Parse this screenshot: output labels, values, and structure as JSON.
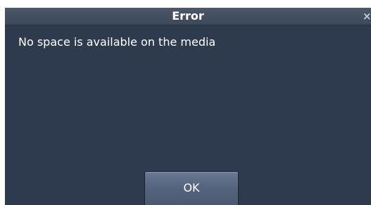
{
  "dialog": {
    "title": "Error",
    "close_glyph": "×",
    "message": "No space is available on the media",
    "ok_label": "OK"
  },
  "colors": {
    "dialog_background": "#2e3a4e",
    "titlebar": "#4a5669",
    "text": "#ffffff",
    "button": "#5a6a84"
  },
  "icons": {
    "close": "close-icon"
  }
}
